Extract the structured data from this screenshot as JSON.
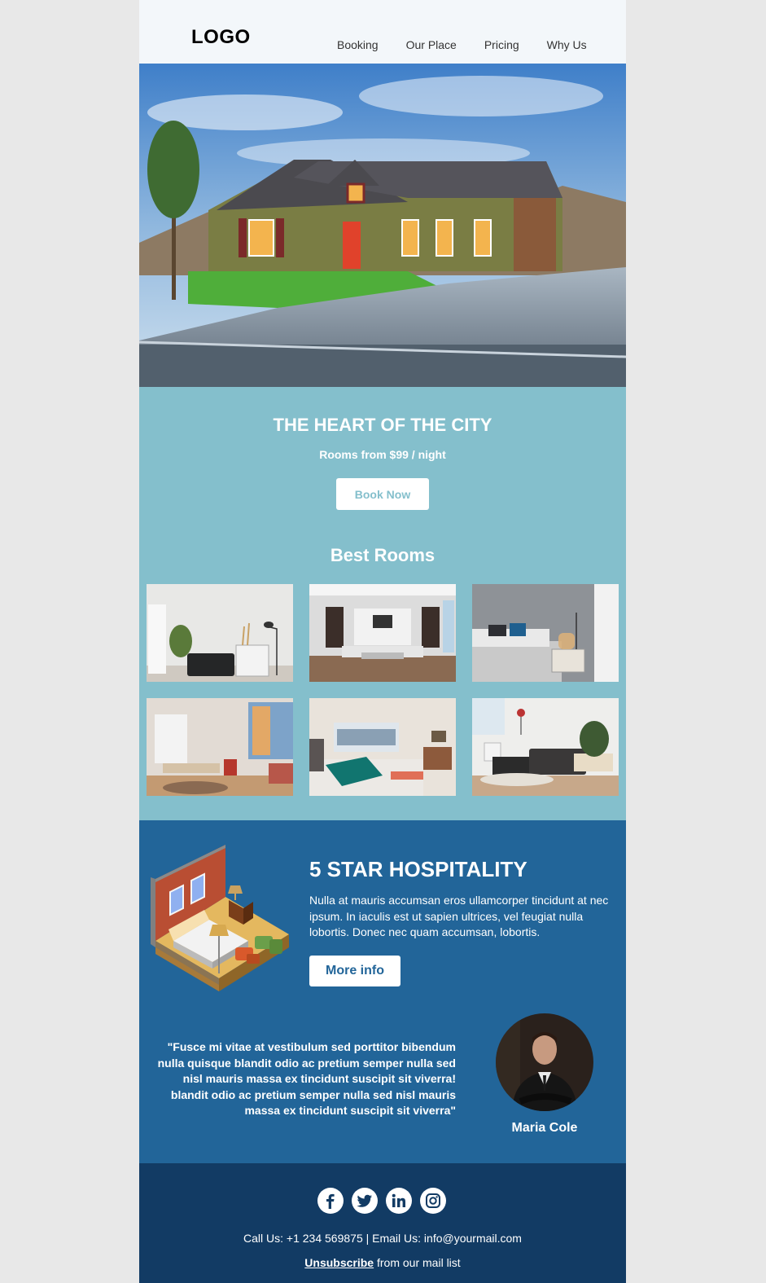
{
  "header": {
    "logo": "LOGO",
    "nav": [
      "Booking",
      "Our Place",
      "Pricing",
      "Why Us"
    ]
  },
  "hero": {
    "title": "THE HEART OF THE CITY",
    "subtitle": "Rooms from $99 / night",
    "cta": "Book Now"
  },
  "rooms": {
    "title": "Best Rooms"
  },
  "hospitality": {
    "title": "5 STAR HOSPITALITY",
    "text": "Nulla at mauris accumsan eros ullamcorper tincidunt at nec ipsum. In iaculis est ut sapien ultrices, vel feugiat nulla lobortis. Donec nec quam accumsan, lobortis.",
    "cta": "More info"
  },
  "testimonial": {
    "quote": "\"Fusce mi vitae at vestibulum sed porttitor bibendum nulla quisque blandit odio ac pretium semper nulla sed nisl mauris massa ex tincidunt suscipit sit viverra! blandit odio ac pretium semper nulla sed nisl mauris massa ex tincidunt suscipit sit viverra\"",
    "name": "Maria Cole"
  },
  "footer": {
    "social_icons": [
      "facebook-icon",
      "twitter-icon",
      "linkedin-icon",
      "instagram-icon"
    ],
    "contact": "Call Us: +1 234 569875 | Email Us: info@yourmail.com",
    "unsubscribe": "Unsubscribe",
    "unsubscribe_suffix": " from our mail list"
  },
  "colors": {
    "teal": "#84bfcc",
    "blue": "#226599",
    "navy": "#123b64",
    "header_bg": "#f3f7fa"
  }
}
